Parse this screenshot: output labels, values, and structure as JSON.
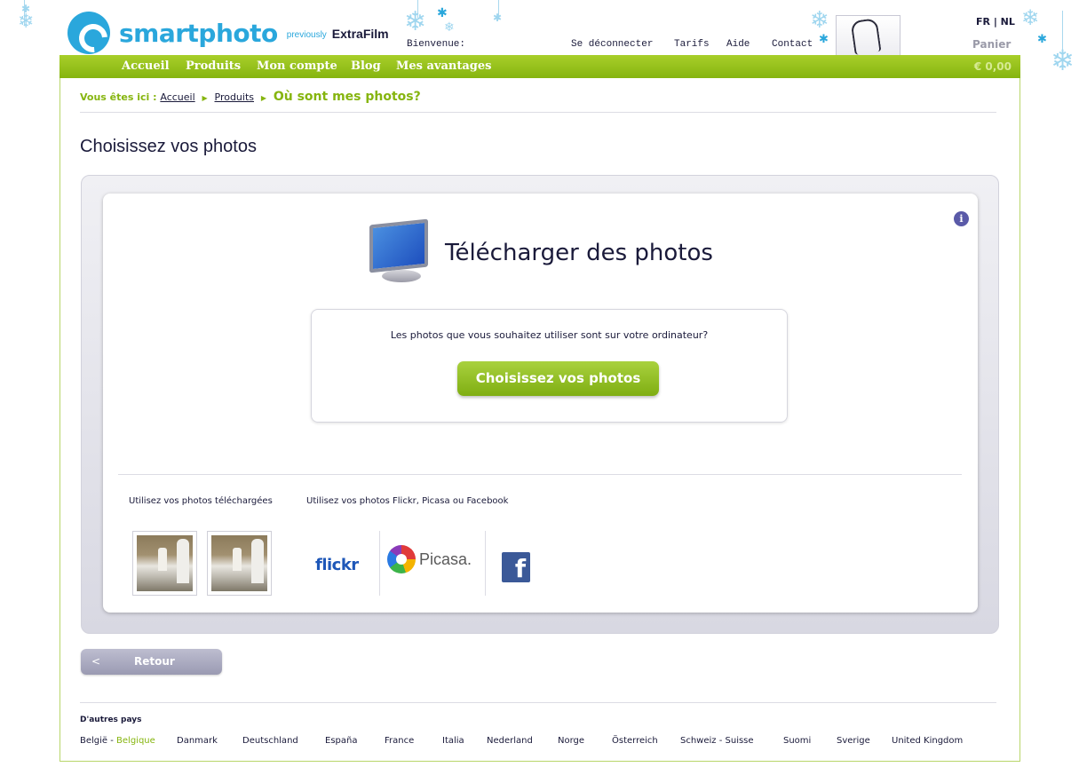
{
  "header": {
    "logo_word": "smartphoto",
    "logo_previously": "previously",
    "logo_extrafilm": "ExtraFilm",
    "welcome": "Bienvenue:",
    "links": [
      "Se déconnecter",
      "Tarifs",
      "Aide",
      "Contact"
    ],
    "lang": "FR | NL",
    "cart_label": "Panier",
    "cart_price": "€ 0,00"
  },
  "nav": [
    "Accueil",
    "Produits",
    "Mon compte",
    "Blog",
    "Mes avantages"
  ],
  "breadcrumb": {
    "prefix": "Vous êtes ici :",
    "items": [
      "Accueil",
      "Produits"
    ],
    "current": "Où sont mes photos?"
  },
  "page_title": "Choisissez vos photos",
  "upload": {
    "title": "Télécharger des photos",
    "question": "Les photos que vous souhaitez utiliser sont sur votre ordinateur?",
    "button": "Choisissez vos photos"
  },
  "sources": {
    "uploaded_label": "Utilisez vos photos téléchargées",
    "online_label": "Utilisez vos photos Flickr, Picasa ou Facebook",
    "flickr_a": "flickr",
    "picasa": "Picasa.",
    "facebook": "f"
  },
  "back": {
    "label": "Retour"
  },
  "footer": {
    "heading": "D'autres pays",
    "belgium_nl": "België - ",
    "belgium_fr": "Belgique",
    "countries": [
      "Danmark",
      "Deutschland",
      "España",
      "France",
      "Italia",
      "Nederland",
      "Norge",
      "Österreich",
      "Schweiz - Suisse",
      "Suomi",
      "Sverige",
      "United Kingdom"
    ]
  },
  "colors": {
    "brand_blue": "#2aa7dc",
    "brand_green": "#86b50f",
    "text_dark": "#1a1a3a"
  }
}
